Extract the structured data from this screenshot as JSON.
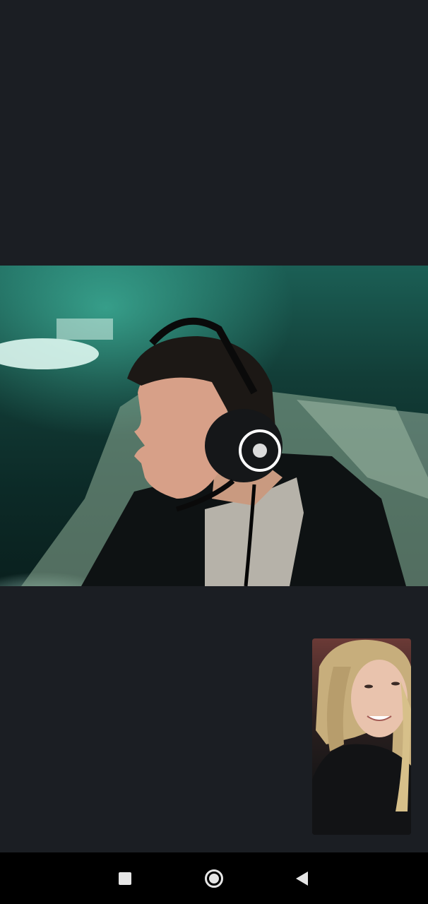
{
  "call": {
    "remote_video": {
      "description_icon": "remote-participant-video"
    },
    "self_view": {
      "description_icon": "self-camera-preview"
    }
  },
  "nav_bar": {
    "buttons": [
      {
        "name": "recents",
        "icon": "square-icon"
      },
      {
        "name": "home",
        "icon": "circle-icon"
      },
      {
        "name": "back",
        "icon": "triangle-back-icon"
      }
    ]
  },
  "colors": {
    "background": "#1b1e23",
    "nav_bar": "#000000",
    "nav_icon": "#e6e6e6",
    "video_tint": "#1b5f55"
  }
}
